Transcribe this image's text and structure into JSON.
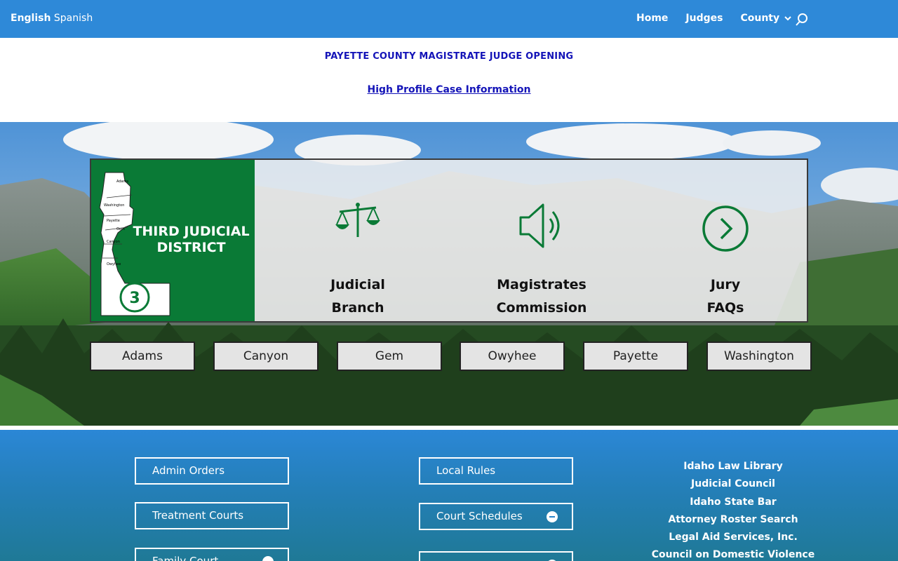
{
  "topbar": {
    "lang_english": "English",
    "lang_spanish": "Spanish",
    "nav": [
      "Home",
      "Judges",
      "County"
    ]
  },
  "announce": {
    "opening": "PAYETTE COUNTY MAGISTRATE JUDGE OPENING",
    "high_profile": "High Profile Case Information"
  },
  "panel": {
    "district_title_1": "THIRD JUDICIAL",
    "district_title_2": "DISTRICT",
    "district_number": "3",
    "map_counties": [
      "Adams",
      "Washington",
      "Payette",
      "Gem",
      "Canyon",
      "Owyhee"
    ],
    "features": [
      {
        "line1": "Judicial",
        "line2": "Branch",
        "icon": "scales-icon"
      },
      {
        "line1": "Magistrates",
        "line2": "Commission",
        "icon": "speaker-icon"
      },
      {
        "line1": "Jury",
        "line2": "FAQs",
        "icon": "arrow-circle-icon"
      }
    ]
  },
  "counties": [
    "Adams",
    "Canyon",
    "Gem",
    "Owyhee",
    "Payette",
    "Washington"
  ],
  "lower": {
    "left_buttons": [
      "Admin Orders",
      "Treatment Courts",
      "Family Court"
    ],
    "middle_buttons": [
      "Local Rules",
      "Court Schedules",
      ""
    ],
    "links": [
      "Idaho Law Library",
      "Judicial Council",
      "Idaho State Bar",
      "Attorney Roster Search",
      "Legal Aid Services, Inc.",
      "Council on Domestic Violence"
    ]
  },
  "colors": {
    "topbar": "#2e89d8",
    "district_green": "#0a7a36",
    "announce_blue": "#1414b8"
  }
}
